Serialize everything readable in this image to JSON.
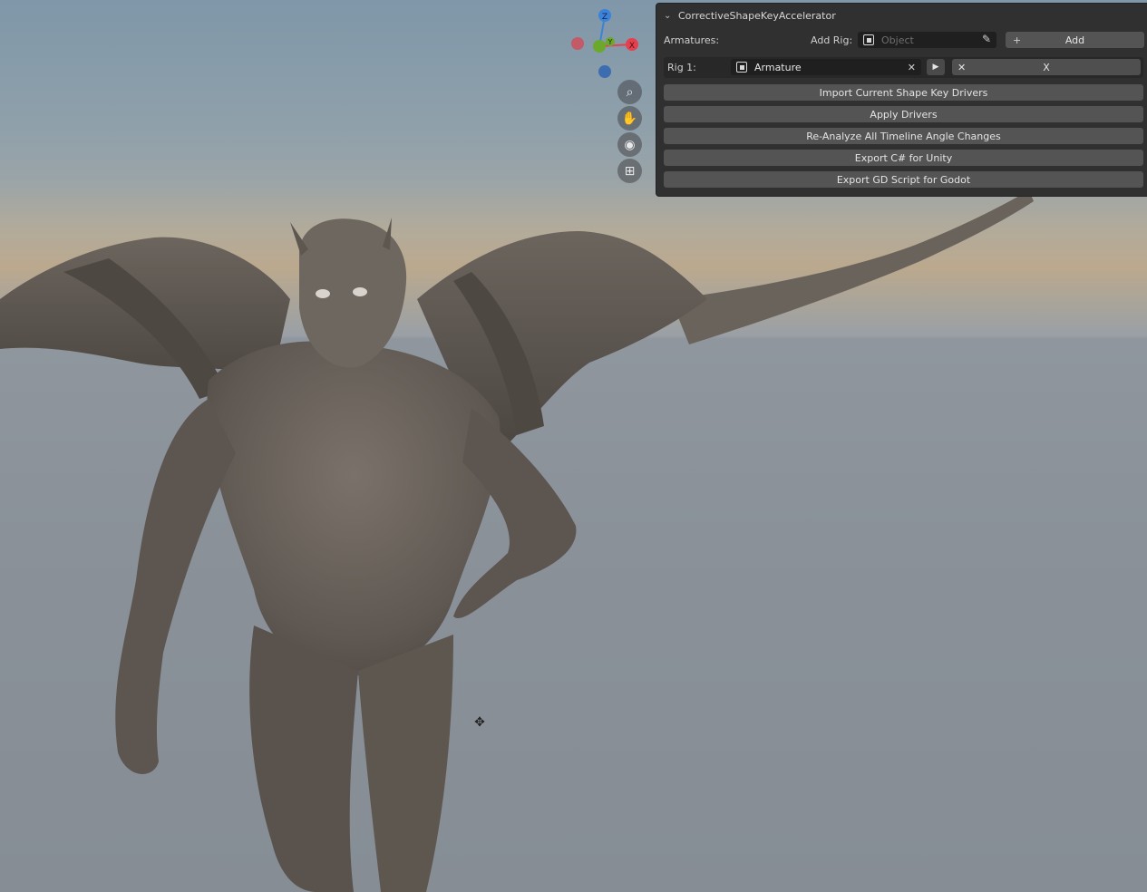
{
  "panel": {
    "title": "CorrectiveShapeKeyAccelerator",
    "armatures_label": "Armatures:",
    "add_rig_label": "Add Rig:",
    "object_placeholder": "Object",
    "add_button": "Add",
    "add_plus": "+",
    "rig_label": "Rig 1:",
    "rig_value": "Armature",
    "clear_x": "✕",
    "play_icon": "play-icon",
    "extra_x_left": "✕",
    "extra_x_right": "X",
    "buttons": [
      "Import Current Shape Key Drivers",
      "Apply Drivers",
      "Re-Analyze All Timeline Angle Changes",
      "Export C# for Unity",
      "Export GD Script for Godot"
    ]
  },
  "gizmo": {
    "z_label": "Z",
    "y_label": "Y",
    "x_label": "X",
    "colors": {
      "x": "#e6404f",
      "y": "#6ca82b",
      "z": "#3b82d9"
    }
  },
  "nav_icons": [
    "zoom-icon",
    "pan-hand-icon",
    "camera-icon",
    "perspective-grid-icon"
  ],
  "cursor_icon": "move-cursor-icon"
}
